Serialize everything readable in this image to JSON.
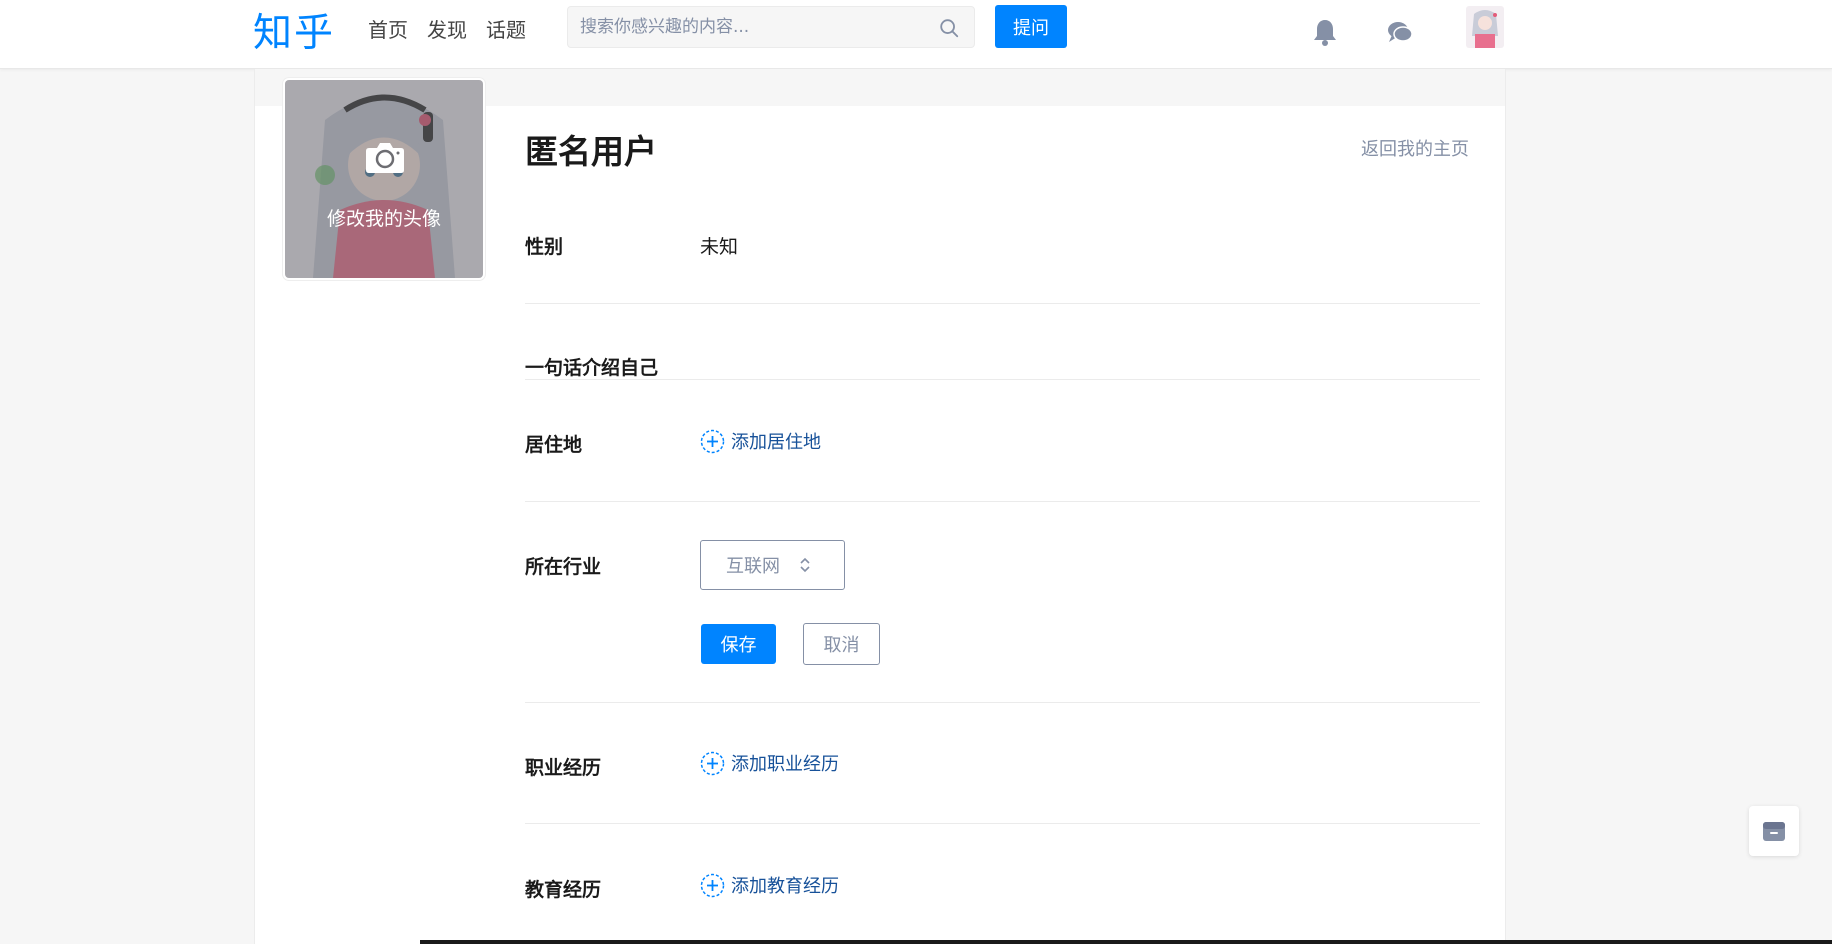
{
  "header": {
    "logo": "知乎",
    "nav": [
      "首页",
      "发现",
      "话题"
    ],
    "search_placeholder": "搜索你感兴趣的内容...",
    "ask_label": "提问"
  },
  "profile": {
    "avatar_label": "修改我的头像",
    "name": "匿名用户",
    "back_link": "返回我的主页",
    "gender": {
      "label": "性别",
      "value": "未知"
    },
    "headline": {
      "label": "一句话介绍自己"
    },
    "location": {
      "label": "居住地",
      "add": "添加居住地"
    },
    "industry": {
      "label": "所在行业",
      "selected": "互联网",
      "save": "保存",
      "cancel": "取消"
    },
    "career": {
      "label": "职业经历",
      "add": "添加职业经历"
    },
    "education": {
      "label": "教育经历",
      "add": "添加教育经历"
    }
  },
  "colors": {
    "brand": "#0084ff",
    "link": "#175199",
    "muted": "#8590a6"
  }
}
